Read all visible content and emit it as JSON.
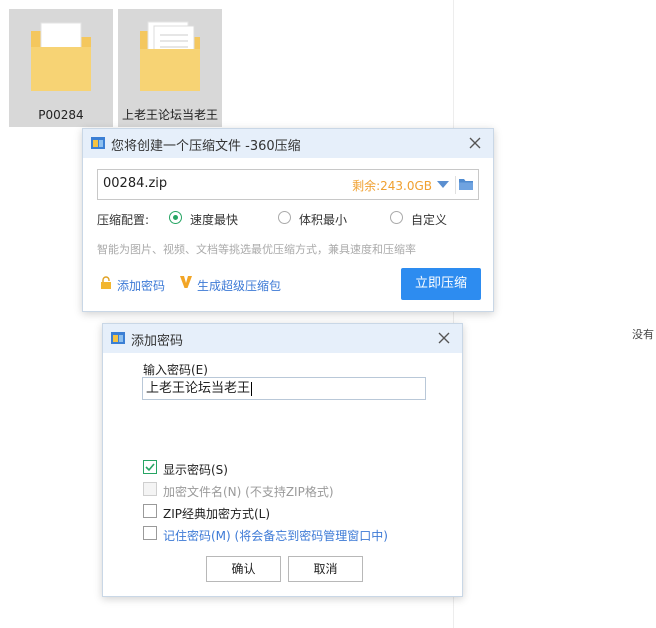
{
  "desktop": {
    "files": [
      {
        "name": "P00284",
        "icon": "folder-icon"
      },
      {
        "name": "上老王论坛当老王",
        "icon": "folder-icon"
      }
    ],
    "side_text": "没有"
  },
  "compress_dialog": {
    "title": "您将创建一个压缩文件 -360压缩",
    "filename": "00284.zip",
    "remaining": "剩余:243.0GB",
    "config_label": "压缩配置:",
    "options": [
      "速度最快",
      "体积最小",
      "自定义"
    ],
    "selected_option": "速度最快",
    "hint": "智能为图片、视频、文档等挑选最优压缩方式，兼具速度和压缩率",
    "add_password_link": "添加密码",
    "super_zip_link": "生成超级压缩包",
    "compress_button": "立即压缩",
    "accent_color": "#2d8cf0",
    "remaining_color": "#f0a030"
  },
  "password_dialog": {
    "title": "添加密码",
    "input_label": "输入密码(E)",
    "password_value": "上老王论坛当老王",
    "show_password": "显示密码(S)",
    "encrypt_filenames": "加密文件名(N) (不支持ZIP格式)",
    "zip_classic": "ZIP经典加密方式(L)",
    "remember_password": "记住密码(M) (将会备忘到密码管理窗口中)",
    "ok_button": "确认",
    "cancel_button": "取消",
    "checked_color": "#27a564"
  }
}
